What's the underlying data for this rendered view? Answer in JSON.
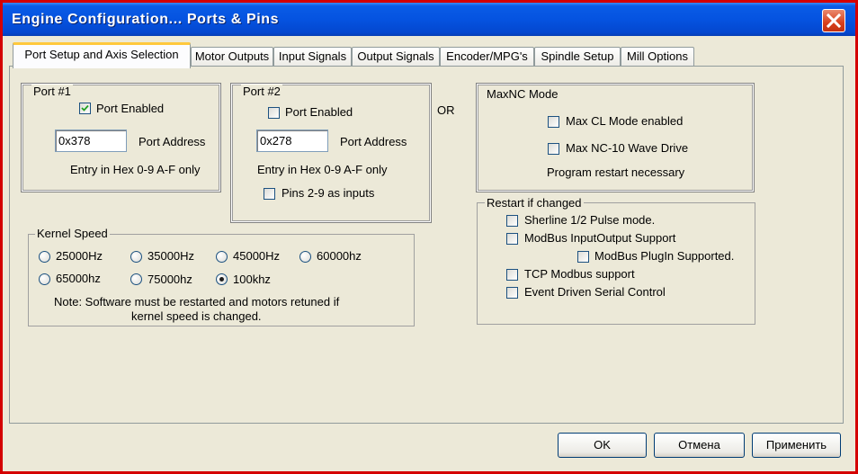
{
  "window": {
    "title": "Engine Configuration... Ports & Pins"
  },
  "tabs": [
    {
      "label": "Port Setup and Axis Selection",
      "active": true
    },
    {
      "label": "Motor Outputs"
    },
    {
      "label": "Input Signals"
    },
    {
      "label": "Output Signals"
    },
    {
      "label": "Encoder/MPG's"
    },
    {
      "label": "Spindle Setup"
    },
    {
      "label": "Mill Options"
    }
  ],
  "port1": {
    "legend": "Port #1",
    "enabled_label": "Port Enabled",
    "enabled": true,
    "address_value": "0x378",
    "address_label": "Port Address",
    "hint": "Entry in Hex 0-9 A-F only"
  },
  "port2": {
    "legend": "Port #2",
    "enabled_label": "Port Enabled",
    "enabled": false,
    "address_value": "0x278",
    "address_label": "Port Address",
    "hint": "Entry in Hex 0-9 A-F only",
    "pins_label": "Pins 2-9 as inputs",
    "pins_checked": false
  },
  "or_label": "OR",
  "maxnc": {
    "legend": "MaxNC Mode",
    "cl_mode_label": "Max CL Mode enabled",
    "wave_label": "Max NC-10 Wave Drive",
    "note": "Program restart necessary"
  },
  "kernel": {
    "legend": "Kernel Speed",
    "options": [
      "25000Hz",
      "35000Hz",
      "45000Hz",
      "60000hz",
      "65000hz",
      "75000hz",
      "100khz"
    ],
    "selected": "100khz",
    "note_line1": "Note: Software must be restarted and motors retuned if",
    "note_line2": "kernel speed is changed."
  },
  "restart": {
    "legend": "Restart if changed",
    "sherline": "Sherline 1/2 Pulse mode.",
    "modbus_io": "ModBus InputOutput Support",
    "modbus_plugin": "ModBus PlugIn Supported.",
    "tcp_modbus": "TCP Modbus support",
    "event_serial": "Event Driven Serial Control"
  },
  "buttons": {
    "ok": "OK",
    "cancel": "Отмена",
    "apply": "Применить"
  }
}
